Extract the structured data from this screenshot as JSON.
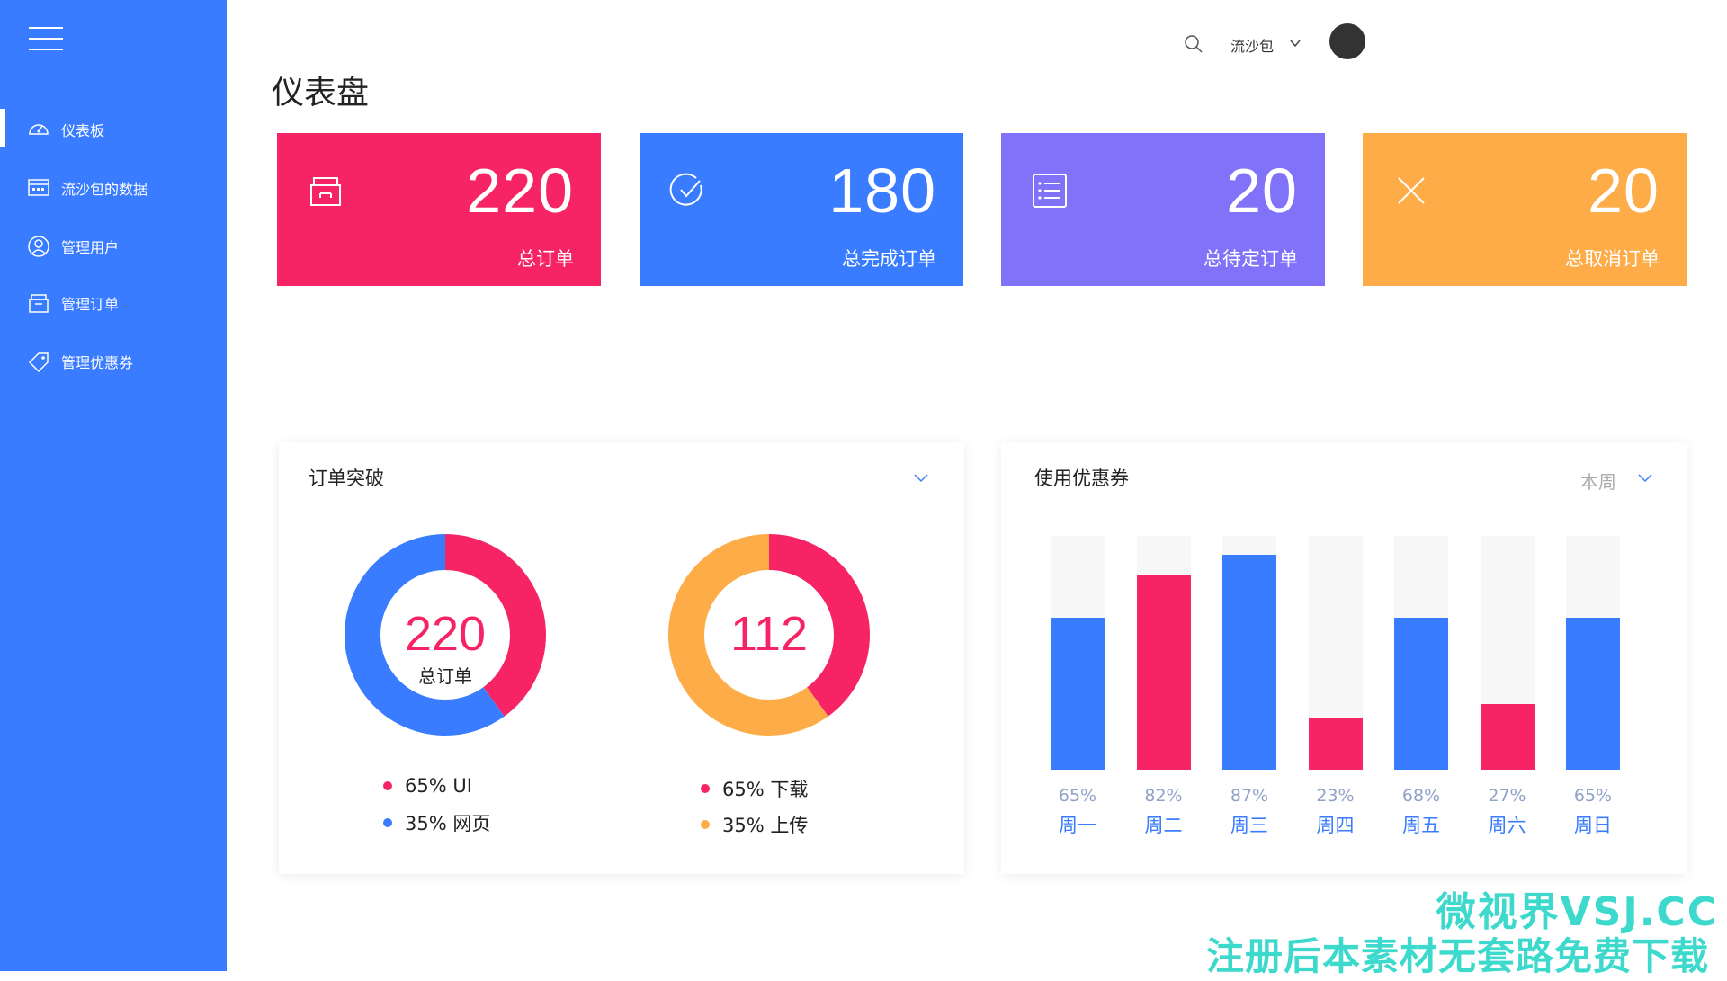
{
  "sidebar": {
    "items": [
      {
        "label": "仪表板",
        "icon": "dashboard-gauge-icon"
      },
      {
        "label": "流沙包的数据",
        "icon": "data-calendar-icon"
      },
      {
        "label": "管理用户",
        "icon": "user-icon"
      },
      {
        "label": "管理订单",
        "icon": "order-box-icon"
      },
      {
        "label": "管理优惠券",
        "icon": "coupon-tag-icon"
      }
    ],
    "active_index": 0
  },
  "topbar": {
    "username": "流沙包",
    "search_icon": "search-icon",
    "dropdown_icon": "chevron-down-icon",
    "avatar_icon": "avatar"
  },
  "page": {
    "title": "仪表盘"
  },
  "stats": [
    {
      "value": "220",
      "label": "总订单",
      "color": "#f72465",
      "icon": "archive-box-icon"
    },
    {
      "value": "180",
      "label": "总完成订单",
      "color": "#3a7cff",
      "icon": "check-circle-icon"
    },
    {
      "value": "20",
      "label": "总待定订单",
      "color": "#8173f9",
      "icon": "checklist-icon"
    },
    {
      "value": "20",
      "label": "总取消订单",
      "color": "#fdac48",
      "icon": "close-icon"
    }
  ],
  "order_panel": {
    "title": "订单突破",
    "donut1": {
      "center_value": "220",
      "center_sub": "总订单",
      "legend": [
        {
          "text": "65% UI",
          "color": "#f72465"
        },
        {
          "text": "35% 网页",
          "color": "#3a7cff"
        }
      ]
    },
    "donut2": {
      "center_value": "112",
      "legend": [
        {
          "text": "65% 下载",
          "color": "#f72465"
        },
        {
          "text": "35% 上传",
          "color": "#fdac48"
        }
      ]
    }
  },
  "coupon_panel": {
    "title": "使用优惠券",
    "period": "本周"
  },
  "chart_data": [
    {
      "type": "pie",
      "subtype": "donut",
      "center_label": "220",
      "center_sublabel": "总订单",
      "slices": [
        {
          "name": "UI",
          "percent": 40,
          "color": "#f72465"
        },
        {
          "name": "网页",
          "percent": 60,
          "color": "#3a7cff"
        }
      ]
    },
    {
      "type": "pie",
      "subtype": "donut",
      "center_label": "112",
      "slices": [
        {
          "name": "下载",
          "percent": 40,
          "color": "#f72465"
        },
        {
          "name": "上传",
          "percent": 60,
          "color": "#fdac48"
        }
      ]
    },
    {
      "type": "bar",
      "categories": [
        "周一",
        "周二",
        "周三",
        "周四",
        "周五",
        "周六",
        "周日"
      ],
      "values": [
        65,
        82,
        87,
        23,
        68,
        27,
        65
      ],
      "value_labels": [
        "65%",
        "82%",
        "87%",
        "23%",
        "68%",
        "27%",
        "65%"
      ],
      "bar_fill_fractions": [
        0.65,
        0.83,
        0.92,
        0.22,
        0.65,
        0.28,
        0.65
      ],
      "bar_colors": [
        "#3a7cff",
        "#f72465",
        "#3a7cff",
        "#f72465",
        "#3a7cff",
        "#f72465",
        "#3a7cff"
      ],
      "ylim": [
        0,
        100
      ]
    }
  ],
  "watermark": {
    "line1": "微视界VSJ.CC",
    "line2": "注册后本素材无套路免费下载"
  }
}
